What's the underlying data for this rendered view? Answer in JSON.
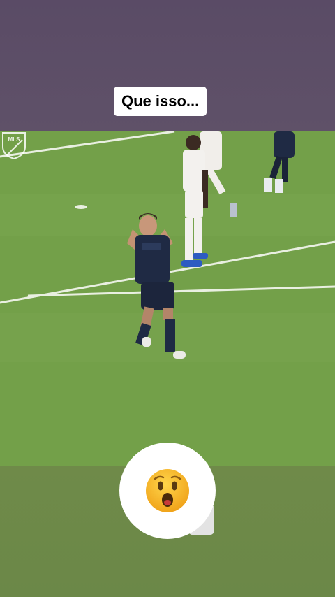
{
  "story": {
    "caption": "Que isso...",
    "broadcast_logo": "mls-crest-icon",
    "reaction": "astonished-face-icon"
  },
  "colors": {
    "top_band": "#5e4f67",
    "pitch": "#76a04c",
    "bottom_band": "#6d8948",
    "home_kit": "#1f2a44",
    "away_kit": "#f2f0ee",
    "emoji_yellow": "#f7b21b"
  }
}
